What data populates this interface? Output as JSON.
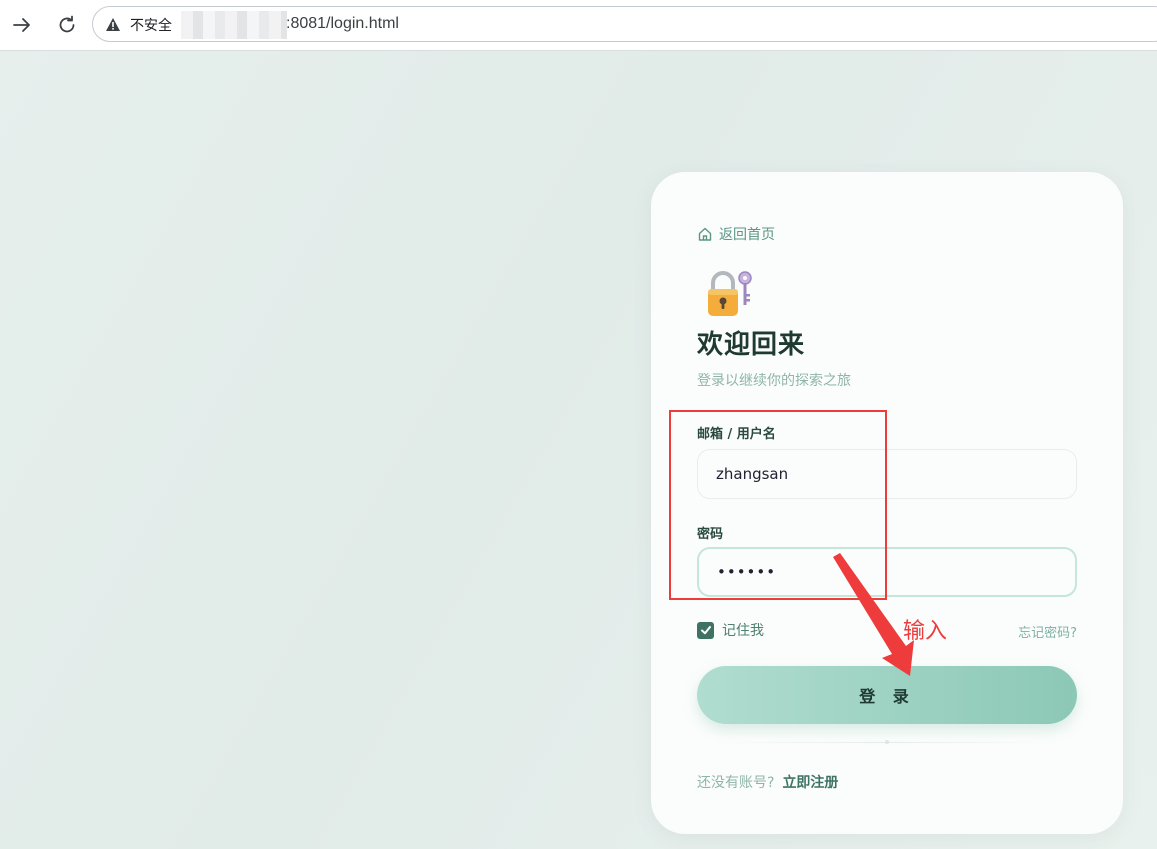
{
  "browser": {
    "insecure_label": "不安全",
    "url": ":8081/login.html"
  },
  "card": {
    "back_link": "返回首页",
    "title": "欢迎回来",
    "subtitle": "登录以继续你的探索之旅",
    "username_label": "邮箱 / 用户名",
    "username_value": "zhangsan",
    "password_label": "密码",
    "password_value": "••••••",
    "remember_label": "记住我",
    "remember_checked": true,
    "forgot_link": "忘记密码?",
    "login_button": "登 录",
    "no_account_text": "还没有账号?",
    "register_link": "立即注册"
  },
  "annotation": {
    "text": "输入",
    "color": "#ee3c3c"
  },
  "colors": {
    "accent": "#3e7364",
    "button_gradient_start": "#b0ddd0",
    "button_gradient_end": "#8cc8b6",
    "annotation_red": "#ee3c3c"
  }
}
